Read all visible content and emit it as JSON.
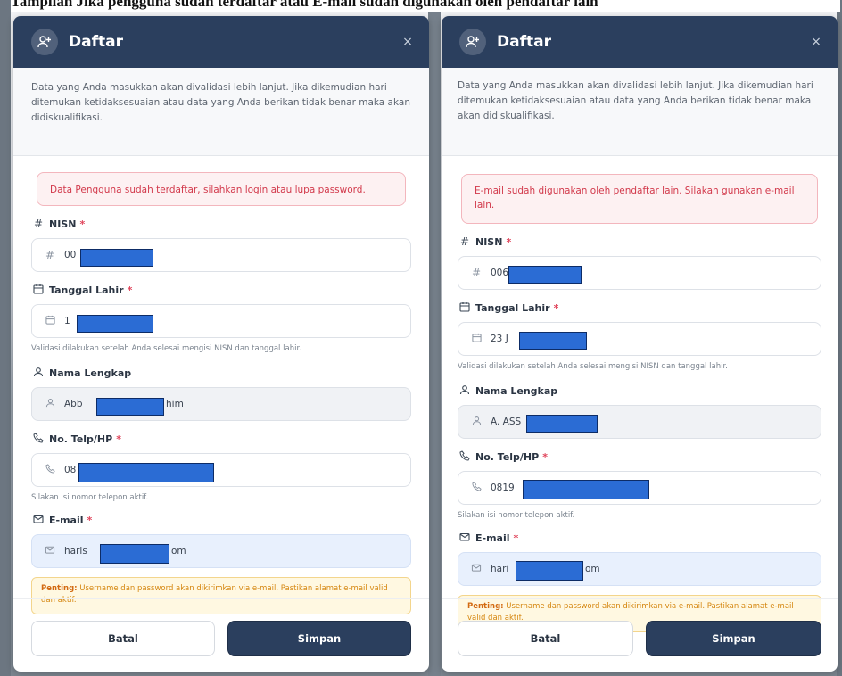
{
  "caption": "Tampilan Jika pengguna sudah terdaftar atau E-mail sudah digunakan oleh pendaftar lain",
  "colors": {
    "header": "#2b3f5e",
    "error": "#d2394b",
    "warning": "#d5860f",
    "redaction": "#2b6cd4"
  },
  "modal_left": {
    "title": "Daftar",
    "close": "×",
    "intro": "Data yang Anda masukkan akan divalidasi lebih lanjut. Jika dikemudian hari ditemukan ketidaksesuaian atau data yang Anda berikan tidak benar maka akan didiskualifikasi.",
    "error": "Data Pengguna sudah terdaftar, silahkan login atau lupa password.",
    "nisn_label": "NISN",
    "nisn_value": "00",
    "dob_label": "Tanggal Lahir",
    "dob_value": "1",
    "dob_hint": "Validasi dilakukan setelah Anda selesai mengisi NISN dan tanggal lahir.",
    "name_label": "Nama Lengkap",
    "name_value_start": "Abb",
    "name_value_end": "him",
    "phone_label": "No. Telp/HP",
    "phone_value": "08",
    "phone_hint": "Silakan isi nomor telepon aktif.",
    "email_label": "E-mail",
    "email_value_start": "haris",
    "email_value_end": "om",
    "note_bold": "Penting:",
    "note_text": " Username dan password akan dikirimkan via e-mail. Pastikan alamat e-mail valid dan aktif.",
    "cancel": "Batal",
    "save": "Simpan",
    "required_mark": "*"
  },
  "modal_right": {
    "title": "Daftar",
    "close": "×",
    "intro": "Data yang Anda masukkan akan divalidasi lebih lanjut. Jika dikemudian hari ditemukan ketidaksesuaian atau data yang Anda berikan tidak benar maka akan didiskualifikasi.",
    "error": "E-mail sudah digunakan oleh pendaftar lain. Silakan gunakan e-mail lain.",
    "nisn_label": "NISN",
    "nisn_value": "006",
    "dob_label": "Tanggal Lahir",
    "dob_value": "23 J",
    "dob_hint": "Validasi dilakukan setelah Anda selesai mengisi NISN dan tanggal lahir.",
    "name_label": "Nama Lengkap",
    "name_value_start": "A. ASS",
    "name_value_end": "",
    "phone_label": "No. Telp/HP",
    "phone_value": "0819",
    "phone_hint": "Silakan isi nomor telepon aktif.",
    "email_label": "E-mail",
    "email_value_start": "hari",
    "email_value_end": "om",
    "note_bold": "Penting:",
    "note_text": " Username dan password akan dikirimkan via e-mail. Pastikan alamat e-mail valid dan aktif.",
    "cancel": "Batal",
    "save": "Simpan",
    "required_mark": "*"
  }
}
